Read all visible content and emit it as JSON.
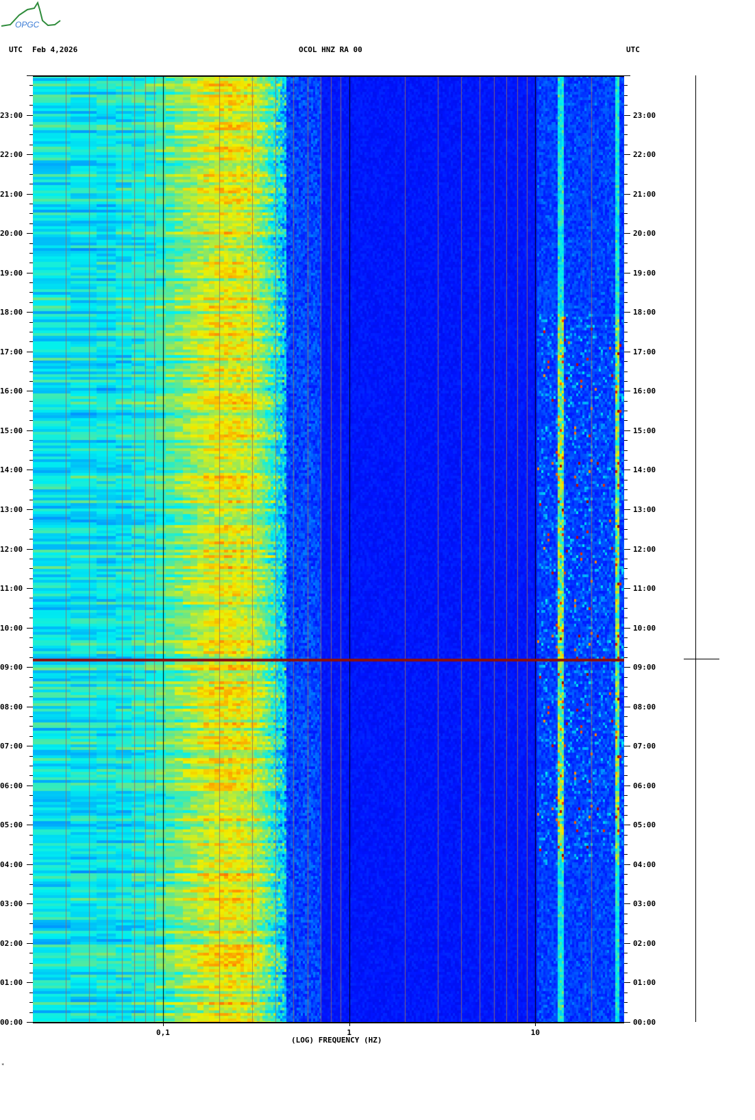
{
  "header": {
    "left_tz": "UTC",
    "date": "Feb 4,2026",
    "station": "OCOL HNZ RA 00",
    "right_tz": "UTC",
    "logo_text": "OPGC"
  },
  "footer_mark": "*",
  "chart_data": {
    "type": "heatmap",
    "title": "OCOL HNZ RA 00",
    "date": "Feb 4,2026",
    "xlabel": "(LOG) FREQUENCY (HZ)",
    "xscale": "log",
    "xlim": [
      0.02,
      30
    ],
    "x_tick_labels": [
      {
        "value": 0.1,
        "label": "0,1"
      },
      {
        "value": 1,
        "label": "1"
      },
      {
        "value": 10,
        "label": "10"
      }
    ],
    "ylabel": "UTC",
    "ylim_hours": [
      0,
      24
    ],
    "y_tick_labels": [
      "00:00",
      "01:00",
      "02:00",
      "03:00",
      "04:00",
      "05:00",
      "06:00",
      "07:00",
      "08:00",
      "09:00",
      "10:00",
      "11:00",
      "12:00",
      "13:00",
      "14:00",
      "15:00",
      "16:00",
      "17:00",
      "18:00",
      "19:00",
      "20:00",
      "21:00",
      "22:00",
      "23:00"
    ],
    "colormap": "jet",
    "features": {
      "microseism_peak_hz": 0.22,
      "noise_floor_above_hz": 0.5,
      "broadband_event_hour": 9.18,
      "cultural_noise_band_hz": [
        10,
        30
      ],
      "cultural_noise_hours": [
        4,
        18
      ],
      "persistent_lines_hz": [
        13.5,
        27
      ]
    }
  }
}
